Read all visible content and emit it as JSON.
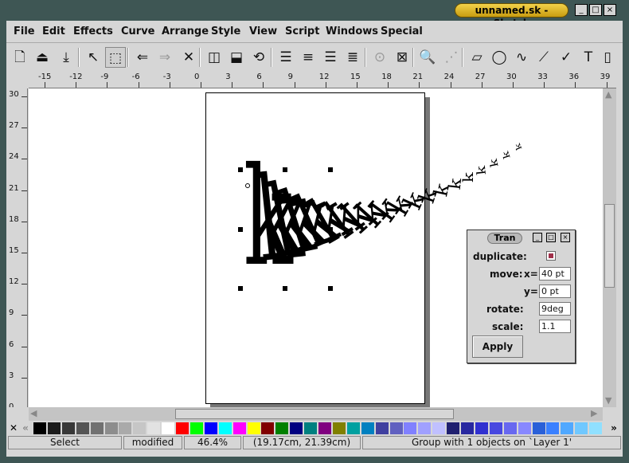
{
  "window": {
    "title": "unnamed.sk - Sketch",
    "controls": [
      "_",
      "□",
      "×"
    ]
  },
  "menu": [
    "File",
    "Edit",
    "Effects",
    "Curve",
    "Arrange",
    "Style",
    "View",
    "Script",
    "Windows",
    "Special"
  ],
  "toolbar": {
    "tools": [
      {
        "name": "new-icon",
        "glyph": "🗋"
      },
      {
        "name": "open-icon",
        "glyph": "⏏"
      },
      {
        "name": "save-icon",
        "glyph": "⤓"
      },
      {
        "name": "edit-tool-icon",
        "glyph": "↖"
      },
      {
        "name": "select-tool-icon",
        "glyph": "⬚"
      },
      {
        "name": "undo-icon",
        "glyph": "⇐"
      },
      {
        "name": "redo-icon",
        "glyph": "⇒"
      },
      {
        "name": "delete-icon",
        "glyph": "✕"
      },
      {
        "name": "flip-horizontal-icon",
        "glyph": "◫"
      },
      {
        "name": "flip-vertical-icon",
        "glyph": "⬓"
      },
      {
        "name": "rotate-icon",
        "glyph": "⟲"
      },
      {
        "name": "align-left-icon",
        "glyph": "☰"
      },
      {
        "name": "align-center-icon",
        "glyph": "≡"
      },
      {
        "name": "align-right-icon",
        "glyph": "☰"
      },
      {
        "name": "align-justify-icon",
        "glyph": "≣"
      },
      {
        "name": "group-icon",
        "glyph": "⊙"
      },
      {
        "name": "ungroup-icon",
        "glyph": "⊠"
      },
      {
        "name": "zoom-icon",
        "glyph": "🔍"
      },
      {
        "name": "grid-icon",
        "glyph": "⋰"
      },
      {
        "name": "rectangle-tool-icon",
        "glyph": "▱"
      },
      {
        "name": "ellipse-tool-icon",
        "glyph": "◯"
      },
      {
        "name": "bezier-tool-icon",
        "glyph": "∿"
      },
      {
        "name": "polyline-tool-icon",
        "glyph": "⟋"
      },
      {
        "name": "freehand-tool-icon",
        "glyph": "✓"
      },
      {
        "name": "text-tool-icon",
        "glyph": "T"
      },
      {
        "name": "image-tool-icon",
        "glyph": "▯"
      }
    ]
  },
  "ruler": {
    "horizontal": [
      "-15",
      "-12",
      "-9",
      "-6",
      "-3",
      "0",
      "3",
      "6",
      "9",
      "12",
      "15",
      "18",
      "21",
      "24",
      "27",
      "30",
      "33",
      "36",
      "39"
    ],
    "vertical": [
      "30",
      "27",
      "24",
      "21",
      "18",
      "15",
      "12",
      "9",
      "6",
      "3",
      "0"
    ]
  },
  "canvas": {
    "glyph": "k"
  },
  "transform_dialog": {
    "title": "Tran",
    "controls": [
      "_",
      "□",
      "×"
    ],
    "duplicate_label": "duplicate:",
    "move_label": "move:",
    "x_label": "x=",
    "x_value": "40 pt",
    "y_label": "y=",
    "y_value": "0 pt",
    "rotate_label": "rotate:",
    "rotate_value": "9deg",
    "scale_label": "scale:",
    "scale_value": "1.1",
    "apply_label": "Apply"
  },
  "palette": {
    "close": "✕",
    "left": "«",
    "right": "»",
    "colors": [
      "#000000",
      "#1c1c1c",
      "#383838",
      "#555555",
      "#717171",
      "#8d8d8d",
      "#aaaaaa",
      "#c6c6c6",
      "#e2e2e2",
      "#ffffff",
      "#ff0000",
      "#00ff00",
      "#0000ff",
      "#00ffff",
      "#ff00ff",
      "#ffff00",
      "#800000",
      "#008000",
      "#000080",
      "#008080",
      "#800080",
      "#808000",
      "#00a0a0",
      "#0080c0",
      "#4040a0",
      "#6060c0",
      "#8080ff",
      "#a0a0ff",
      "#c0c0ff",
      "#202070",
      "#2828a0",
      "#3030d0",
      "#4848e0",
      "#6868f0",
      "#8888ff",
      "#2a60d8",
      "#3a80ff",
      "#50a8ff",
      "#70c8ff",
      "#90e0ff"
    ]
  },
  "status": {
    "mode": "Select",
    "modified": "modified",
    "zoom": "46.4%",
    "position": "(19.17cm, 21.39cm)",
    "selection": "Group with 1 objects on `Layer 1'"
  }
}
